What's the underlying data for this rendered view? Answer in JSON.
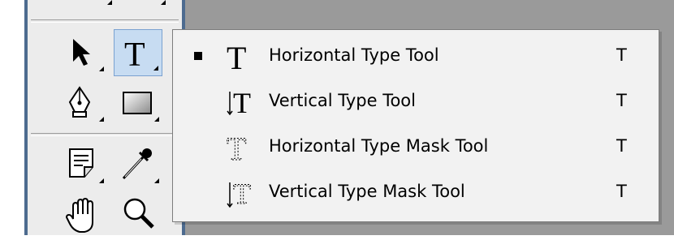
{
  "flyout": {
    "items": [
      {
        "label": "Horizontal Type Tool",
        "shortcut": "T",
        "icon": "horizontal-type-icon",
        "selected": true
      },
      {
        "label": "Vertical Type Tool",
        "shortcut": "T",
        "icon": "vertical-type-icon",
        "selected": false
      },
      {
        "label": "Horizontal Type Mask Tool",
        "shortcut": "T",
        "icon": "horizontal-type-mask-icon",
        "selected": false
      },
      {
        "label": "Vertical Type Mask Tool",
        "shortcut": "T",
        "icon": "vertical-type-mask-icon",
        "selected": false
      }
    ]
  },
  "palette": {
    "tools": [
      {
        "icon": "move-icon",
        "active": false
      },
      {
        "icon": "type-tool-icon",
        "active": true
      },
      {
        "icon": "pen-icon",
        "active": false
      },
      {
        "icon": "rectangle-icon",
        "active": false
      },
      {
        "icon": "notes-icon",
        "active": false
      },
      {
        "icon": "eyedropper-icon",
        "active": false
      },
      {
        "icon": "hand-icon",
        "active": false
      },
      {
        "icon": "zoom-icon",
        "active": false
      }
    ]
  },
  "colors": {
    "active_tool_bg": "#c7dcf2",
    "palette_border": "#4d6b8f",
    "document_area": "#9a9a9a",
    "menu_bg": "#f2f2f2"
  }
}
